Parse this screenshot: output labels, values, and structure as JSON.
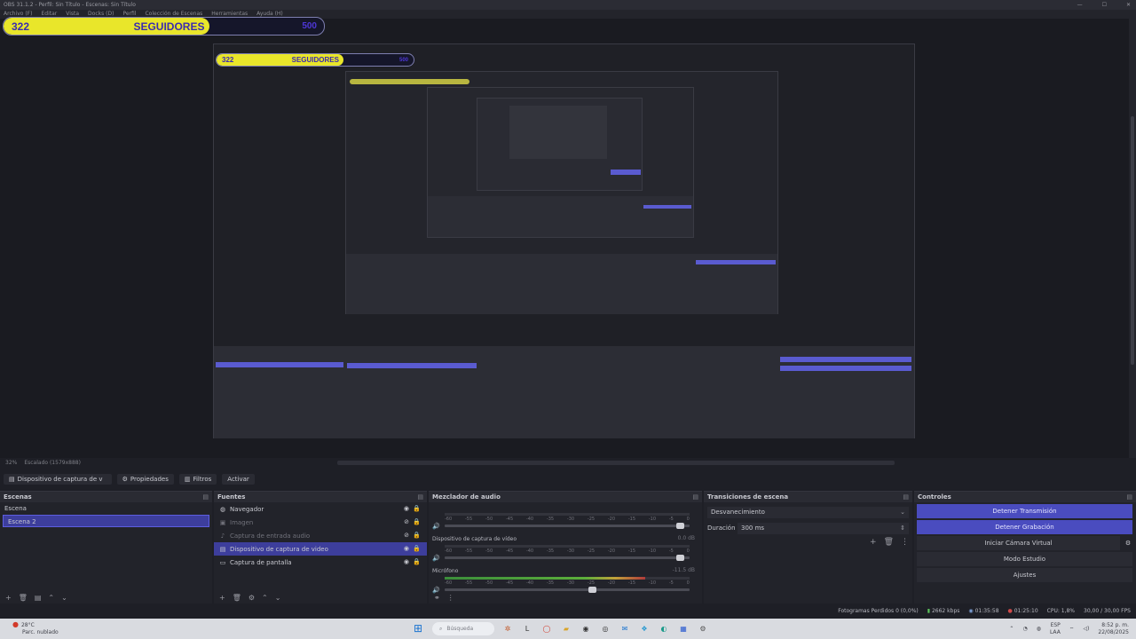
{
  "window": {
    "title": "OBS 31.1.2 - Perfil: Sin Título - Escenas: Sin Título",
    "controls": [
      "—",
      "☐",
      "✕"
    ]
  },
  "menu": [
    "Archivo (F)",
    "Editar",
    "Vista",
    "Docks (D)",
    "Perfil",
    "Colección de Escenas",
    "Herramientas",
    "Ayuda (H)"
  ],
  "overlay": {
    "count": "322",
    "label": "SEGUIDORES",
    "goal": "500",
    "progress": 0.644
  },
  "preview": {
    "zoom": "32%",
    "scale_label": "Escalado (1579x888)"
  },
  "source_toolbar": {
    "source_name": "Dispositivo de captura de v",
    "properties": "Propiedades",
    "filters": "Filtros",
    "activate": "Activar"
  },
  "scenes": {
    "title": "Escenas",
    "items": [
      {
        "label": "Escena",
        "selected": false
      },
      {
        "label": "Escena 2",
        "selected": true
      }
    ]
  },
  "sources": {
    "title": "Fuentes",
    "items": [
      {
        "label": "Navegador",
        "icon": "globe-icon",
        "glyph": "◍",
        "dim": false,
        "selected": false,
        "hidden": false
      },
      {
        "label": "Imagen",
        "icon": "image-icon",
        "glyph": "▣",
        "dim": true,
        "selected": false,
        "hidden": true
      },
      {
        "label": "Captura de entrada audio",
        "icon": "mic-icon",
        "glyph": "♪",
        "dim": true,
        "selected": false,
        "hidden": true
      },
      {
        "label": "Dispositivo de captura de video",
        "icon": "camera-icon",
        "glyph": "▤",
        "dim": false,
        "selected": true,
        "hidden": false
      },
      {
        "label": "Captura de pantalla",
        "icon": "monitor-icon",
        "glyph": "▭",
        "dim": false,
        "selected": false,
        "hidden": false
      }
    ]
  },
  "mixer": {
    "title": "Mezclador de audio",
    "ticks": [
      "-60",
      "-55",
      "-50",
      "-45",
      "-40",
      "-35",
      "-30",
      "-25",
      "-20",
      "-15",
      "-10",
      "-5",
      "0"
    ],
    "channels": [
      {
        "label": "",
        "db": "",
        "level": 0.0,
        "fader": 0.98
      },
      {
        "label": "Dispositivo de captura de vídeo",
        "db": "0.0 dB",
        "level": 0.0,
        "fader": 0.98
      },
      {
        "label": "Micrófono",
        "db": "-11.5 dB",
        "level": 0.82,
        "fader": 0.62
      }
    ]
  },
  "transitions": {
    "title": "Transiciones de escena",
    "selected": "Desvanecimiento",
    "duration_label": "Duración",
    "duration_value": "300 ms"
  },
  "controls": {
    "title": "Controles",
    "buttons": [
      {
        "label": "Detener Transmisión",
        "active": true
      },
      {
        "label": "Detener Grabación",
        "active": true
      },
      {
        "label": "Iniciar Cámara Virtual",
        "active": false
      },
      {
        "label": "Modo Estudio",
        "active": false
      },
      {
        "label": "Ajustes",
        "active": false
      }
    ]
  },
  "status": {
    "dropped": "Fotogramas Perdidos 0 (0,0%)",
    "bitrate": "2662 kbps",
    "stream_time": "01:35:58",
    "rec_time": "01:25:10",
    "cpu": "CPU: 1,8%",
    "fps": "30,00 / 30,00 FPS"
  },
  "taskbar": {
    "weather_temp": "28°C",
    "weather_desc": "Parc. nublado",
    "search_placeholder": "Búsqueda",
    "lang": "ESP",
    "lang_region": "LAA",
    "time": "8:52 p. m.",
    "date": "22/08/2025"
  },
  "colors": {
    "accent": "#4a4cbf",
    "overlay_fill": "#e9e62a",
    "overlay_text": "#3a2bb0",
    "meter_green": "#5cae3b",
    "meter_red": "#b03a3a"
  }
}
